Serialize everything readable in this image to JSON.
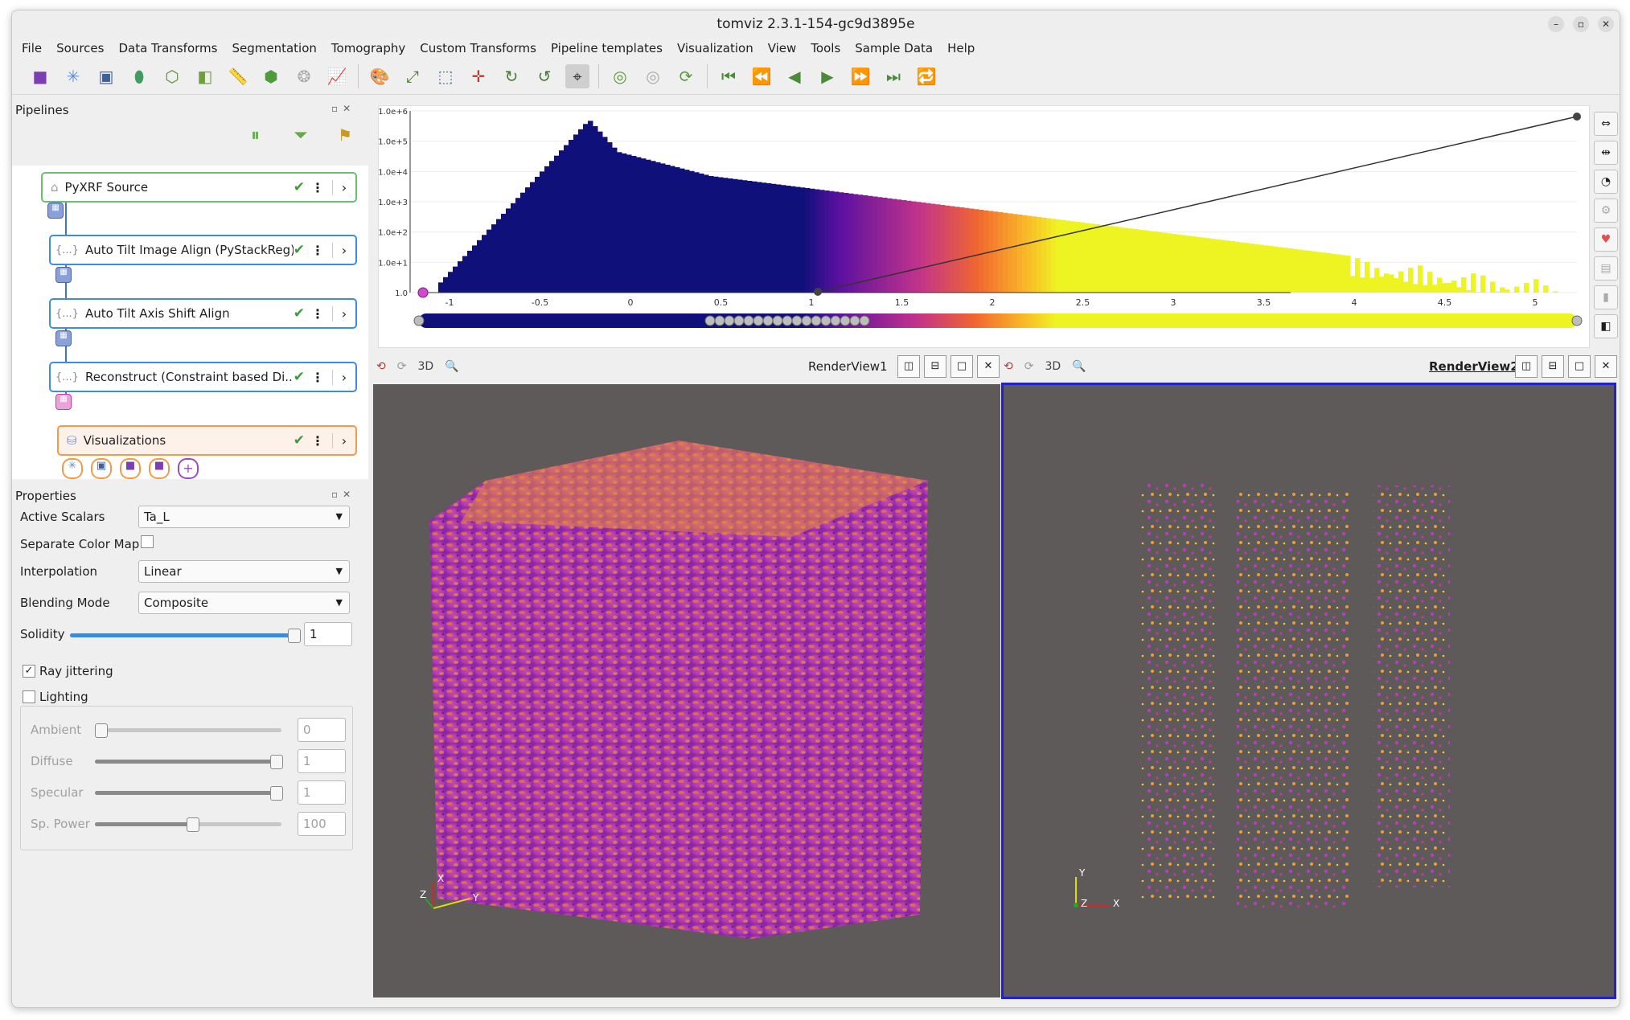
{
  "window": {
    "title": "tomviz 2.3.1-154-gc9d3895e"
  },
  "menu": [
    "File",
    "Sources",
    "Data Transforms",
    "Segmentation",
    "Tomography",
    "Custom Transforms",
    "Pipeline templates",
    "Visualization",
    "View",
    "Tools",
    "Sample Data",
    "Help"
  ],
  "pipelines": {
    "title": "Pipelines",
    "nodes": [
      {
        "label": "PyXRF Source",
        "status": "✔"
      },
      {
        "label": "Auto Tilt Image Align (PyStackReg)",
        "status": "✔"
      },
      {
        "label": "Auto Tilt Axis Shift Align",
        "status": "✔"
      },
      {
        "label": "Reconstruct (Constraint based Di...",
        "status": "✔"
      },
      {
        "label": "Visualizations",
        "status": "✔"
      }
    ]
  },
  "properties": {
    "title": "Properties",
    "active_scalars_label": "Active Scalars",
    "active_scalars_value": "Ta_L",
    "separate_color_map_label": "Separate Color Map",
    "interpolation_label": "Interpolation",
    "interpolation_value": "Linear",
    "blending_label": "Blending Mode",
    "blending_value": "Composite",
    "solidity_label": "Solidity",
    "solidity_value": "1",
    "ray_jittering_label": "Ray jittering",
    "lighting_label": "Lighting",
    "ambient_label": "Ambient",
    "ambient_value": "0",
    "diffuse_label": "Diffuse",
    "diffuse_value": "1",
    "specular_label": "Specular",
    "specular_value": "1",
    "sppower_label": "Sp. Power",
    "sppower_value": "100"
  },
  "histogram": {
    "ytick_labels": [
      "1.0e+6",
      "1.0e+5",
      "1.0e+4",
      "1.0e+3",
      "1.0e+2",
      "1.0e+1",
      "1.0"
    ],
    "xtick_labels": [
      "-1",
      "-0.5",
      "0",
      "0.5",
      "1",
      "1.5",
      "2",
      "2.5",
      "3",
      "3.5",
      "4",
      "4.5",
      "5"
    ]
  },
  "views": {
    "left": {
      "title": "RenderView1",
      "mode": "3D"
    },
    "right": {
      "title": "RenderView2",
      "mode": "3D"
    }
  },
  "axes_left": {
    "x": "X",
    "y": "Y",
    "z": "Z"
  },
  "axes_right": {
    "x": "X",
    "y": "Y",
    "z": "Z"
  },
  "colors": {
    "accent": "#3c8de0",
    "histogram_low": "#10107a",
    "histogram_high": "#eef422",
    "render_bg": "#5e5a59"
  }
}
